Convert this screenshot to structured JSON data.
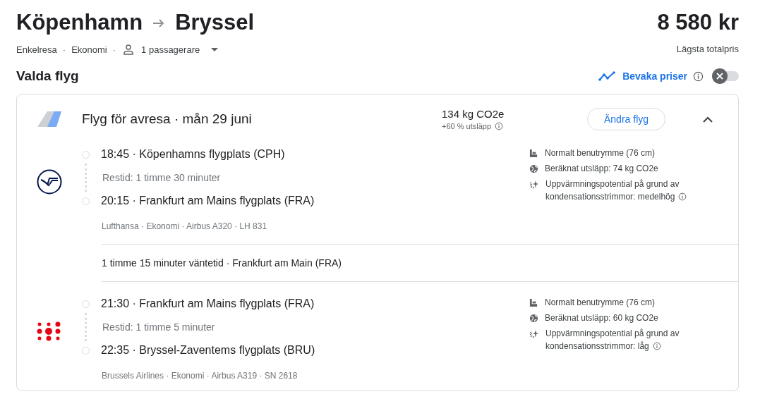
{
  "route": {
    "origin": "Köpenhamn",
    "destination": "Bryssel"
  },
  "trip_options": [
    {
      "text": "Enkelresa",
      "separator": "·"
    },
    {
      "text": "Ekonomi",
      "separator": "·"
    }
  ],
  "passengers": "1 passagerare",
  "price": "8 580 kr",
  "price_caption": "Lägsta totalpris",
  "section_title": "Valda flyg",
  "price_tracking": {
    "label": "Bevaka priser",
    "on": false
  },
  "card": {
    "title": "Flyg för avresa · mån 29 juni",
    "emissions": "134 kg CO2e",
    "emissions_delta": "+60 % utsläpp",
    "change_button": "Ändra flyg",
    "expanded": true,
    "segments": [
      {
        "kind": "lufthansa",
        "departure": "18:45 · Köpenhamns flygplats (CPH)",
        "duration": "Restid: 1 timme 30 minuter",
        "arrival": "20:15 · Frankfurt am Mains flygplats (FRA)",
        "details": "Lufthansa · Ekonomi · Airbus A320 · LH 831",
        "amenities": [
          {
            "kind": "legroom",
            "text": "Normalt benutrymme (76 cm)",
            "info": false
          },
          {
            "kind": "emissions",
            "text": "Beräknat utsläpp: 74 kg CO2e",
            "info": false
          },
          {
            "kind": "contrails",
            "text": "Uppvärmningspotential på grund av kondensationsstrimmor: medelhög",
            "info": true
          }
        ]
      },
      {
        "kind": "brussels",
        "departure": "21:30 · Frankfurt am Mains flygplats (FRA)",
        "duration": "Restid: 1 timme 5 minuter",
        "arrival": "22:35 · Bryssel-Zaventems flygplats (BRU)",
        "details": "Brussels Airlines · Ekonomi · Airbus A319 · SN 2618",
        "amenities": [
          {
            "kind": "legroom",
            "text": "Normalt benutrymme (76 cm)",
            "info": false
          },
          {
            "kind": "emissions",
            "text": "Beräknat utsläpp: 60 kg CO2e",
            "info": false
          },
          {
            "kind": "contrails",
            "text": "Uppvärmningspotential på grund av kondensationsstrimmor: låg",
            "info": true
          }
        ]
      }
    ],
    "layovers": [
      "1 timme 15 minuter väntetid · Frankfurt am Main (FRA)"
    ]
  }
}
